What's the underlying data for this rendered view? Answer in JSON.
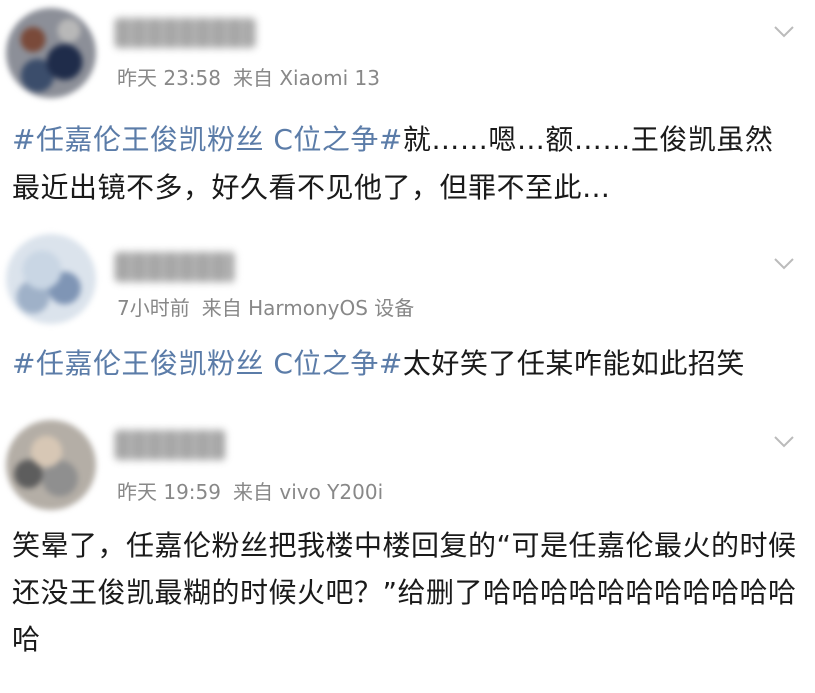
{
  "posts": [
    {
      "time": "昨天 23:58",
      "source": "来自 Xiaomi 13",
      "topic": "#任嘉伦王俊凯粉丝 C位之争#",
      "text": "就……嗯…额……王俊凯虽然最近出镜不多，好久看不见他了，但罪不至此…"
    },
    {
      "time": "7小时前",
      "source": "来自 HarmonyOS 设备",
      "topic": "#任嘉伦王俊凯粉丝 C位之争#",
      "text": "太好笑了任某咋能如此招笑"
    },
    {
      "time": "昨天 19:59",
      "source": "来自 vivo Y200i",
      "topic": "",
      "text": "笑晕了，任嘉伦粉丝把我楼中楼回复的“可是任嘉伦最火的时候还没王俊凯最糊的时候火吧？”给删了哈哈哈哈哈哈哈哈哈哈哈哈"
    }
  ],
  "icons": {
    "more": "chevron-down-icon"
  },
  "colors": {
    "topic": "#5b7ca8",
    "meta": "#888888",
    "text": "#1a1a1a"
  }
}
